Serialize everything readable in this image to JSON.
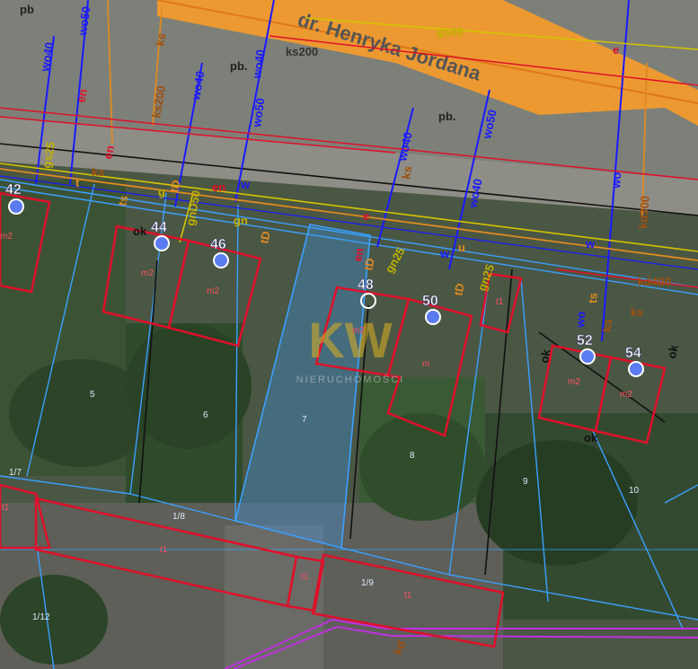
{
  "street": {
    "name": "dr. Henryka Jordana"
  },
  "colors": {
    "road": "#f29a2e",
    "parcel": "#3aa0ff",
    "building": "#e0102a",
    "water": "#1a1aff",
    "gas": "#d4c400",
    "sewer": "#b0601a",
    "power": "#e0102a",
    "telecom": "#c030e0",
    "number_dot": "#5b7cf0"
  },
  "house_numbers": [
    "42",
    "44",
    "46",
    "48",
    "50",
    "52",
    "54"
  ],
  "parcel_numbers": [
    "5",
    "6",
    "7",
    "8",
    "9",
    "10",
    "1/7",
    "1/8",
    "1/9",
    "1/12"
  ],
  "building_labels": {
    "m2": "m2",
    "m": "m",
    "t1": "t1"
  },
  "utility_labels": {
    "pb": "pb",
    "pb_dot": "pb.",
    "wo40": "wo40",
    "wo50": "wo50",
    "wo": "wo",
    "ks200": "ks200",
    "ks": "ks",
    "kd300": "kd300",
    "kd400": "kd400",
    "kd": "kd",
    "gs40": "gs40",
    "gs25": "gs25",
    "gnD50": "gnD50",
    "gn25": "gn25",
    "gn": "gn",
    "g": "g",
    "en": "en",
    "tD": "tD",
    "ts": "ts",
    "t": "t",
    "e": "e",
    "w": "w",
    "ok": "ok",
    "u": "u"
  },
  "watermark": {
    "logo": "KW",
    "text": "NIERUCHOMOŚCI"
  }
}
